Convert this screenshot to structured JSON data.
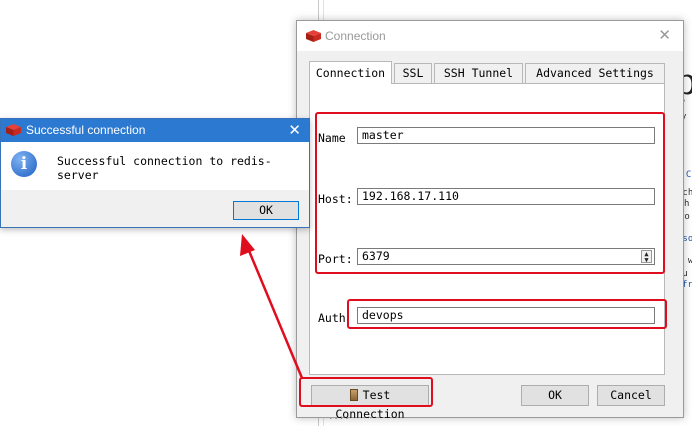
{
  "background": {
    "fragments": [
      "p",
      "y",
      "1 C",
      "_ch",
      "h",
      "ro",
      "nso",
      "k w",
      "tu",
      "fr"
    ],
    "footer": "...."
  },
  "connection_dialog": {
    "title": "Connection",
    "tabs": [
      {
        "label": "Connection",
        "active": true
      },
      {
        "label": "SSL",
        "active": false
      },
      {
        "label": "SSH Tunnel",
        "active": false
      },
      {
        "label": "Advanced Settings",
        "active": false
      }
    ],
    "fields": {
      "name": {
        "label": "Name",
        "value": "master"
      },
      "host": {
        "label": "Host:",
        "value": "192.168.17.110"
      },
      "port": {
        "label": "Port:",
        "value": "6379"
      },
      "auth": {
        "label": "Auth",
        "value": "devops"
      }
    },
    "buttons": {
      "test": "Test Connection",
      "ok": "OK",
      "cancel": "Cancel"
    }
  },
  "success_dialog": {
    "title": "Successful connection",
    "message": "Successful connection to redis-server",
    "ok": "OK"
  },
  "colors": {
    "annotation_red": "#e00d1e",
    "titlebar_blue": "#2b79d0"
  }
}
